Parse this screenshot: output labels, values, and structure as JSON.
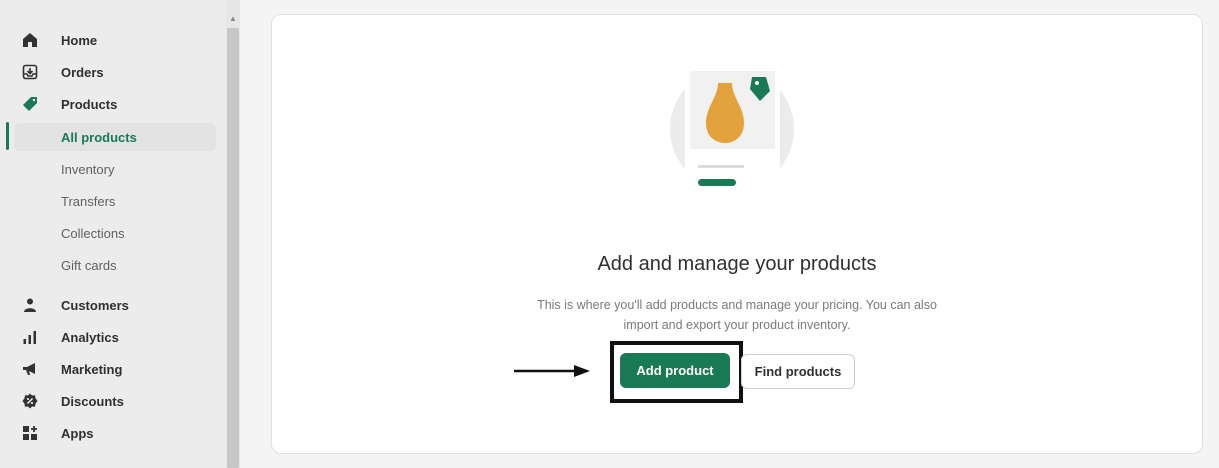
{
  "sidebar": {
    "items": [
      {
        "label": "Home",
        "icon": "home-icon"
      },
      {
        "label": "Orders",
        "icon": "orders-icon"
      },
      {
        "label": "Products",
        "icon": "tag-icon"
      },
      {
        "label": "Customers",
        "icon": "person-icon"
      },
      {
        "label": "Analytics",
        "icon": "bar-chart-icon"
      },
      {
        "label": "Marketing",
        "icon": "megaphone-icon"
      },
      {
        "label": "Discounts",
        "icon": "discount-icon"
      },
      {
        "label": "Apps",
        "icon": "apps-icon"
      }
    ],
    "product_subitems": [
      {
        "label": "All products",
        "active": true
      },
      {
        "label": "Inventory"
      },
      {
        "label": "Transfers"
      },
      {
        "label": "Collections"
      },
      {
        "label": "Gift cards"
      }
    ]
  },
  "main": {
    "title": "Add and manage your products",
    "description": "This is where you'll add products and manage your pricing. You can also import and export your product inventory.",
    "add_product_label": "Add product",
    "find_products_label": "Find products"
  },
  "colors": {
    "accent": "#1a7a55",
    "illustration_vase": "#e3a23b"
  }
}
